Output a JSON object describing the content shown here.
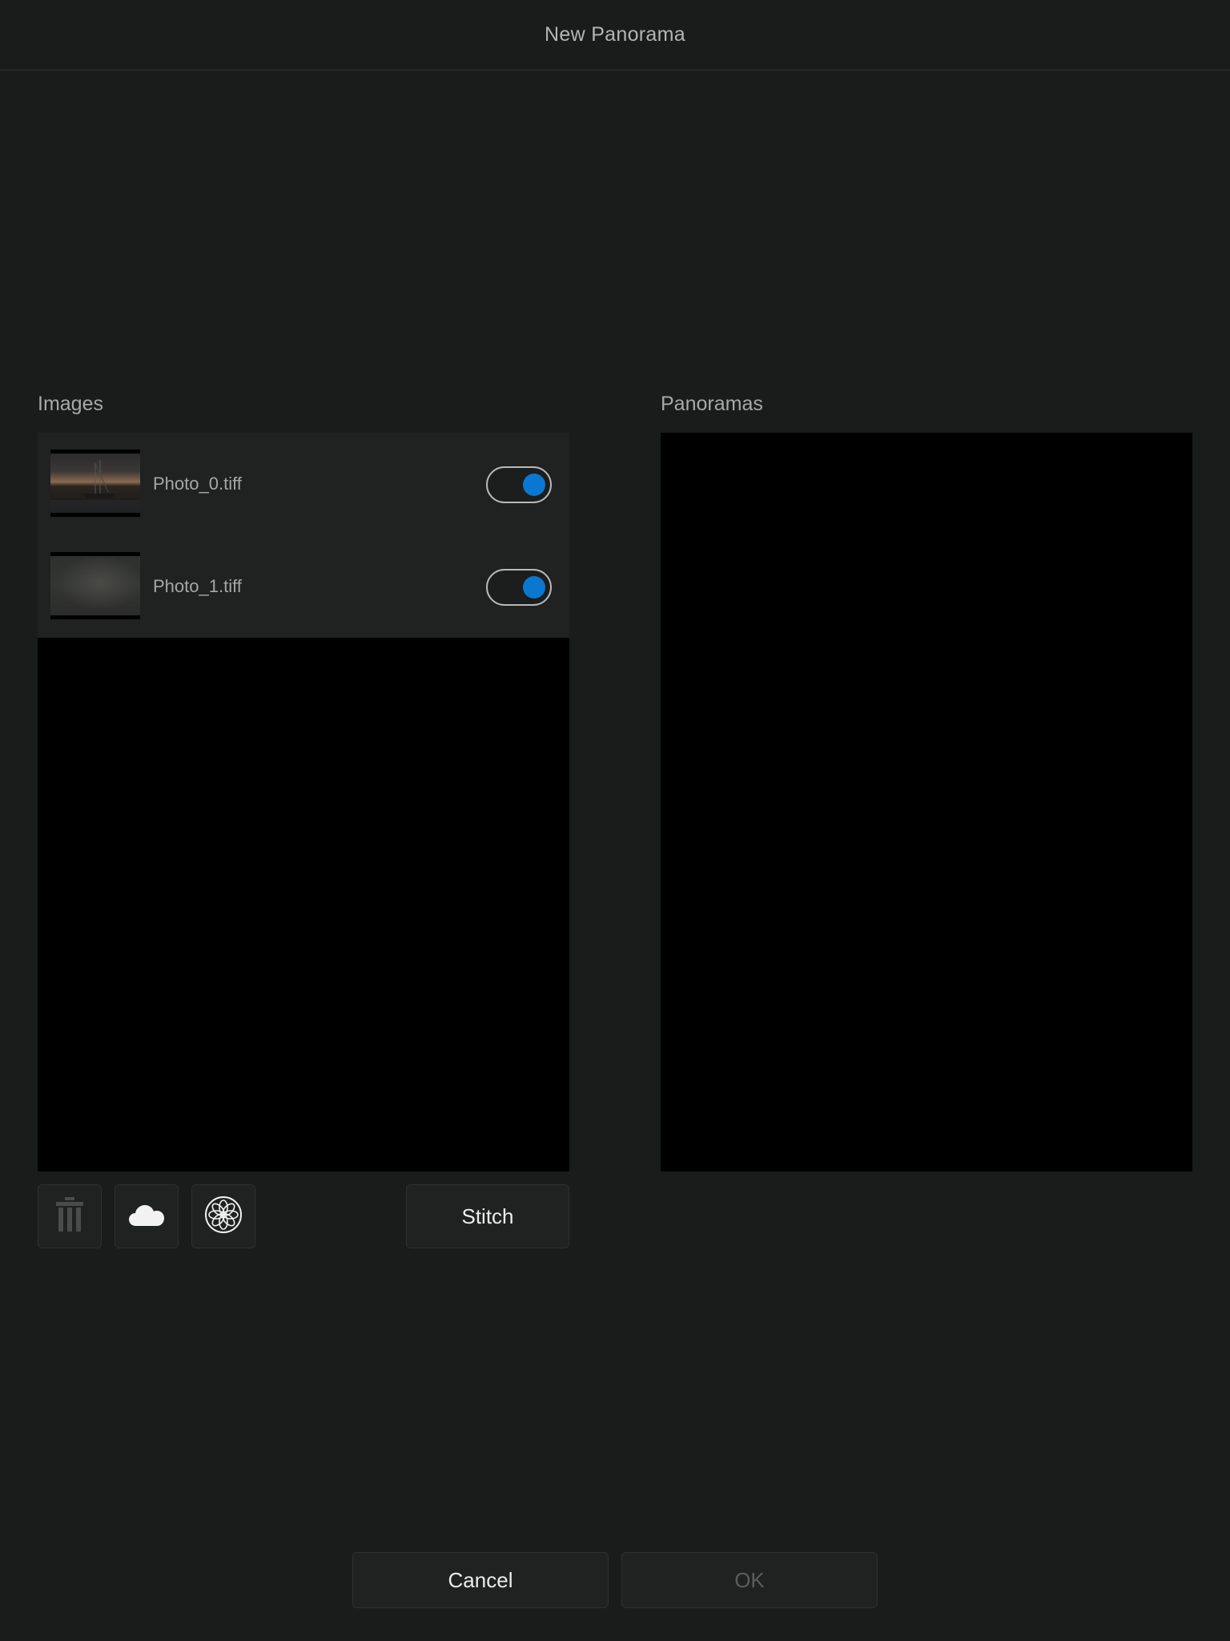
{
  "window": {
    "title": "New Panorama"
  },
  "images": {
    "label": "Images",
    "items": [
      {
        "filename": "Photo_0.tiff",
        "enabled": true
      },
      {
        "filename": "Photo_1.tiff",
        "enabled": true
      }
    ]
  },
  "panoramas": {
    "label": "Panoramas"
  },
  "toolbar": {
    "trash_icon": "trash-icon",
    "cloud_icon": "cloud-icon",
    "photos_icon": "photos-icon",
    "stitch_label": "Stitch"
  },
  "footer": {
    "cancel_label": "Cancel",
    "ok_label": "OK"
  },
  "colors": {
    "background": "#1a1b1b",
    "toggle_on": "#0a78d0",
    "panel": "#000000"
  }
}
